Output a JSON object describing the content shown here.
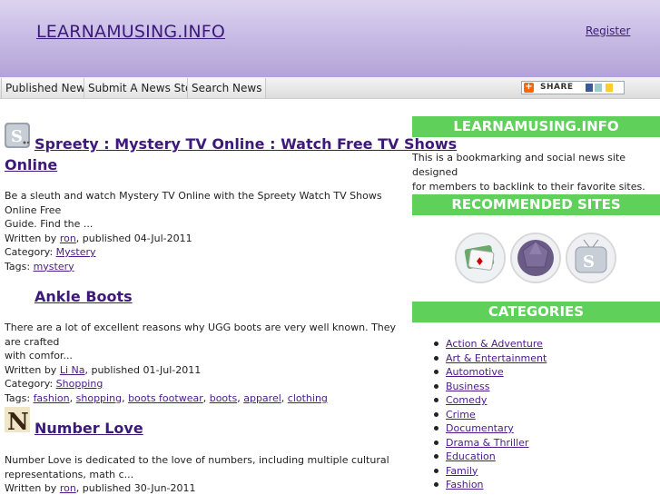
{
  "header": {
    "site_title": "LEARNAMUSING.INFO",
    "register_label": "Register"
  },
  "nav": {
    "items": [
      "Published News",
      "Submit A News Story",
      "Search News"
    ],
    "share_label": "SHARE"
  },
  "posts": [
    {
      "title_line1": "Spreety : Mystery TV Online : Watch Free TV Shows",
      "title_line2": "Online",
      "excerpt_line1": "Be a sleuth and watch Mystery TV Online with the Spreety Watch TV Shows Online Free",
      "excerpt_line2": "Guide. Find the ...",
      "written_by": "Written by ",
      "author": "ron",
      "published": ", published 04-Jul-2011",
      "category_label": "Category: ",
      "category": "Mystery",
      "tags_label": "Tags: ",
      "tags": [
        "mystery"
      ]
    },
    {
      "title_line1": "Ankle Boots",
      "excerpt_line1": "There are a lot of excellent reasons why UGG boots are very well known. They are crafted",
      "excerpt_line2": "with comfor...",
      "written_by": "Written by ",
      "author": "Li Na",
      "published": ", published 01-Jul-2011",
      "category_label": "Category: ",
      "category": "Shopping",
      "tags_label": "Tags: ",
      "tags": [
        "fashion",
        "shopping",
        "boots footwear",
        "boots",
        "apparel",
        "clothing"
      ]
    },
    {
      "title_line1": "Number Love",
      "excerpt_line1": "Number Love is dedicated to the love of numbers, including multiple cultural",
      "excerpt_line2": "representations, math c...",
      "written_by": "Written by ",
      "author": "ron",
      "published": ", published 30-Jun-2011"
    }
  ],
  "sidebar": {
    "site_heading": "LEARNAMUSING.INFO",
    "description_line1": "This is a bookmarking and social news site designed",
    "description_line2": "for members to backlink to their favorite sites.",
    "recommended_heading": "RECOMMENDED SITES",
    "categories_heading": "CATEGORIES",
    "categories": [
      "Action & Adventure",
      "Art & Entertainment",
      "Automotive",
      "Business",
      "Comedy",
      "Crime",
      "Documentary",
      "Drama & Thriller",
      "Education",
      "Family",
      "Fashion"
    ]
  },
  "colors": {
    "accent_green": "#5fd05a",
    "link_purple": "#3d1a7a",
    "header_lavender": "#c9bde6"
  }
}
